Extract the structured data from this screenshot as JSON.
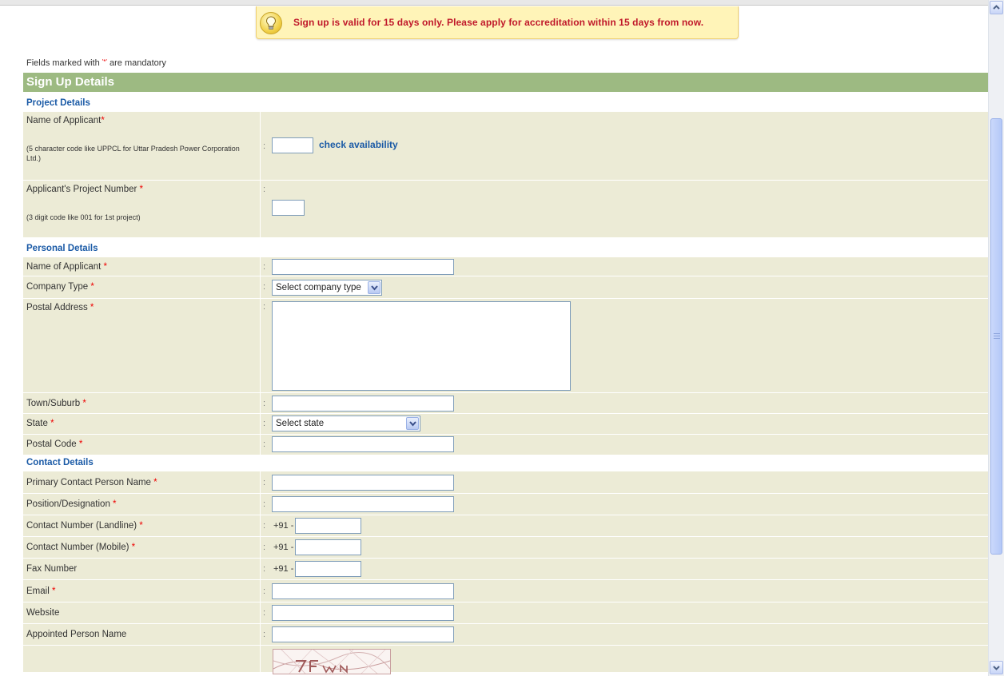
{
  "notice": {
    "text": "Sign up is valid for 15 days only. Please apply for accreditation within 15 days from now.",
    "icon": "lightbulb-icon"
  },
  "mandatory_note": {
    "prefix": "Fields marked with ",
    "marker": "'*'",
    "suffix": " are mandatory"
  },
  "form": {
    "title": "Sign Up Details"
  },
  "sections": {
    "project": "Project Details",
    "personal": "Personal Details",
    "contact": "Contact Details"
  },
  "project": {
    "code": {
      "label": "Name of Applicant",
      "hint": "(5 character code like UPPCL for Uttar Pradesh Power Corporation Ltd.)",
      "link": "check availability"
    },
    "number": {
      "label": "Applicant's Project Number ",
      "hint": "(3 digit code like 001 for 1st project)"
    }
  },
  "personal": {
    "name": "Name of Applicant ",
    "company_type": {
      "label": "Company Type ",
      "selected": "Select company type"
    },
    "address": "Postal Address ",
    "town": "Town/Suburb ",
    "state": {
      "label": "State ",
      "selected": "Select state"
    },
    "postal": "Postal Code "
  },
  "contact": {
    "primary": "Primary Contact Person Name ",
    "position": "Position/Designation ",
    "landline": "Contact Number (Landline) ",
    "mobile": "Contact Number (Mobile) ",
    "fax": "Fax Number",
    "email": "Email ",
    "website": "Website",
    "appointed": "Appointed Person Name",
    "phone_prefix": "+91 -"
  },
  "common": {
    "required": "*",
    "colon": ":"
  },
  "colors": {
    "header_green": "#9dba82",
    "row_beige": "#ecebd6",
    "section_blue": "#1a5aa6",
    "notice_red": "#c0182a",
    "notice_bg": "#fff4b8"
  }
}
